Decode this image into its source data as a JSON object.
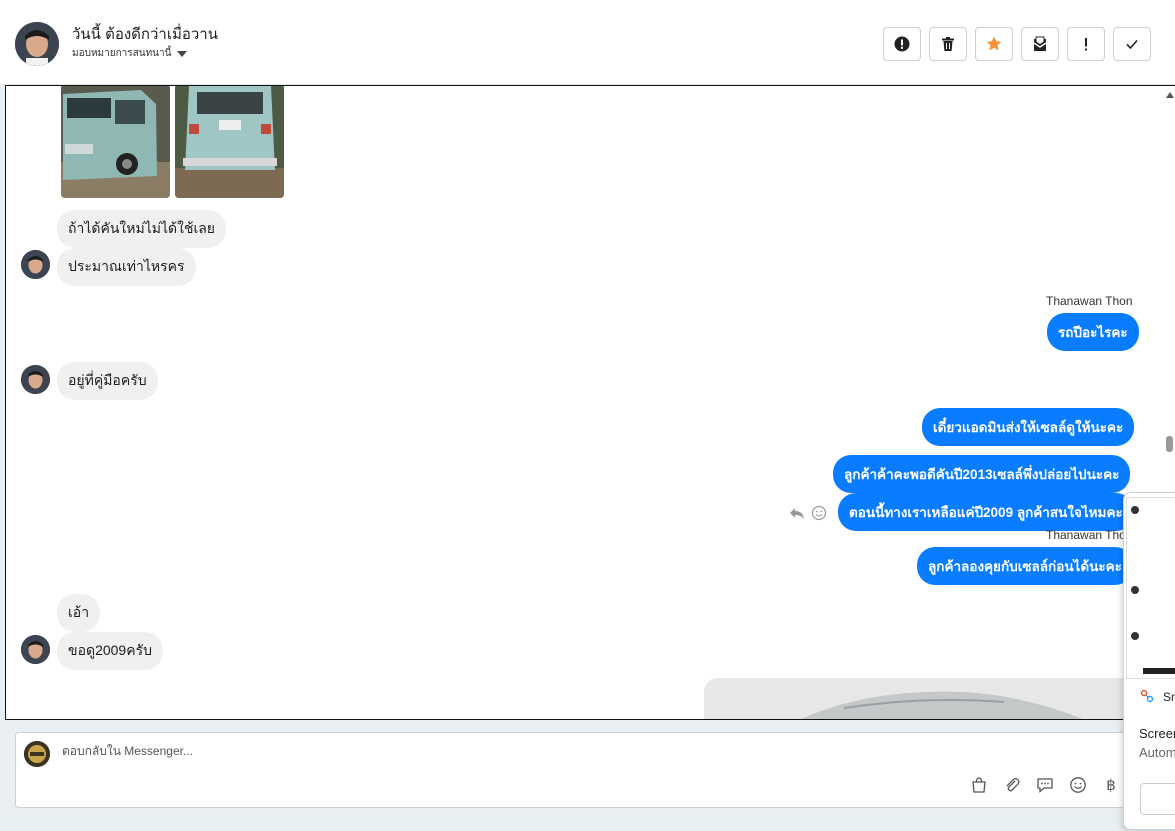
{
  "header": {
    "title": "วันนี้ ต้องดีกว่าเมื่อวาน",
    "subtitle": "มอบหมายการสนทนานี้",
    "actions": [
      {
        "name": "spam",
        "icon": "alert-circle-icon"
      },
      {
        "name": "delete",
        "icon": "trash-icon"
      },
      {
        "name": "star",
        "icon": "star-icon"
      },
      {
        "name": "mark-unread",
        "icon": "envelope-icon"
      },
      {
        "name": "important",
        "icon": "exclamation-icon"
      },
      {
        "name": "done",
        "icon": "check-icon"
      }
    ],
    "star_color": "#f7923b"
  },
  "messages": {
    "in_1": "ถ้าได้คันใหม่ไม่ได้ใช้เลย",
    "in_2": "ประมาณเท่าไหรคร",
    "sender_1": "Thanawan Thon",
    "out_1": "รถปีอะไรคะ",
    "in_3": "อยู่ที่คู่มือครับ",
    "out_2": "เดี๋ยวแอดมินส่งให้เซลล์ดูให้นะคะ",
    "out_3": "ลูกค้าค้าคะพอดีคันปี2013เซลล์พึ่งปล่อยไปนะคะ",
    "out_4": "ตอนนี้ทางเราเหลือแค่ปี2009 ลูกค้าสนใจไหมคะ",
    "sender_2": "Thanawan Thon",
    "out_5": "ลูกค้าลองคุยกับเซลล์ก่อนได้นะคะ",
    "in_4": "เอ้า",
    "in_5": "ขอดู2009ครับ"
  },
  "composer": {
    "placeholder": "ตอบกลับใน Messenger...",
    "tools": [
      "bag-icon",
      "paperclip-icon",
      "chat-bubble-icon",
      "emoji-icon",
      "baht-icon"
    ]
  },
  "popup": {
    "title_partial": "Sm",
    "line1_partial": "Screen",
    "line2_partial": "Autom"
  },
  "colors": {
    "accent": "#0a7cff",
    "incoming_bubble": "#f0f0f0"
  }
}
